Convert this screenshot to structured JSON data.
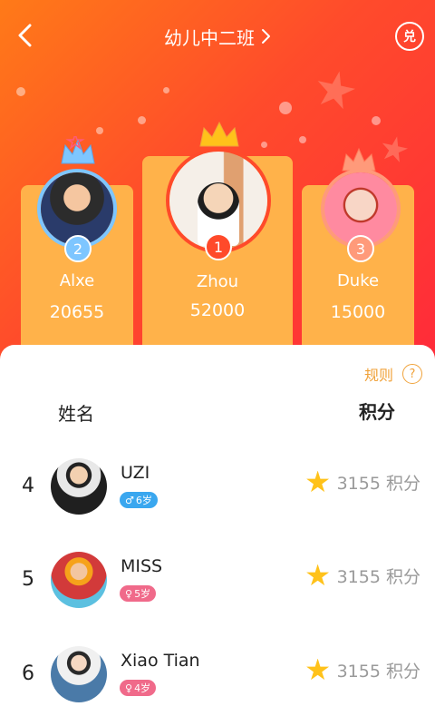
{
  "header": {
    "title": "幼儿中二班",
    "title_chevron_icon": "chevron-right-icon",
    "back_icon": "chevron-left-icon",
    "redeem_label": "兑"
  },
  "podium": {
    "first": {
      "rank": "1",
      "name": "Zhou",
      "score": "52000",
      "crown_color": "#ffc21a"
    },
    "second": {
      "rank": "2",
      "name": "Alxe",
      "score": "20655",
      "crown_color": "#7ec6ff"
    },
    "third": {
      "rank": "3",
      "name": "Duke",
      "score": "15000",
      "crown_color": "#ff9a7a"
    }
  },
  "list": {
    "rules_label": "规则",
    "rules_icon": "?",
    "col_name": "姓名",
    "col_score": "积分",
    "rows": [
      {
        "rank": "4",
        "name": "UZI",
        "gender": "male",
        "gender_symbol": "♂",
        "age": "6岁",
        "score": "3155 积分"
      },
      {
        "rank": "5",
        "name": "MISS",
        "gender": "female",
        "gender_symbol": "♀",
        "age": "5岁",
        "score": "3155 积分"
      },
      {
        "rank": "6",
        "name": "Xiao Tian",
        "gender": "female",
        "gender_symbol": "♀",
        "age": "4岁",
        "score": "3155 积分"
      }
    ]
  },
  "colors": {
    "gradient_start": "#ff7a18",
    "gradient_end": "#ff2a3a",
    "card": "#ffb24a",
    "accent_gold": "#f0a23a",
    "male_tag": "#3aa7ef",
    "female_tag": "#f06a8a",
    "star": "#ffc21a"
  }
}
